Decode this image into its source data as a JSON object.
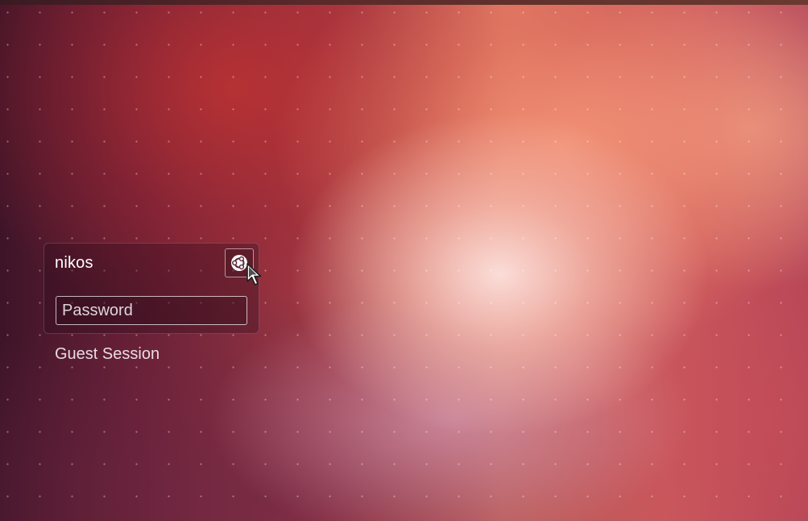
{
  "login": {
    "username": "nikos",
    "session_icon": "ubuntu-session-icon",
    "password": {
      "placeholder": "Password",
      "value": ""
    }
  },
  "guest_session_label": "Guest Session",
  "colors": {
    "text": "#ffffff",
    "panel_bg": "rgba(40,10,25,0.32)"
  }
}
